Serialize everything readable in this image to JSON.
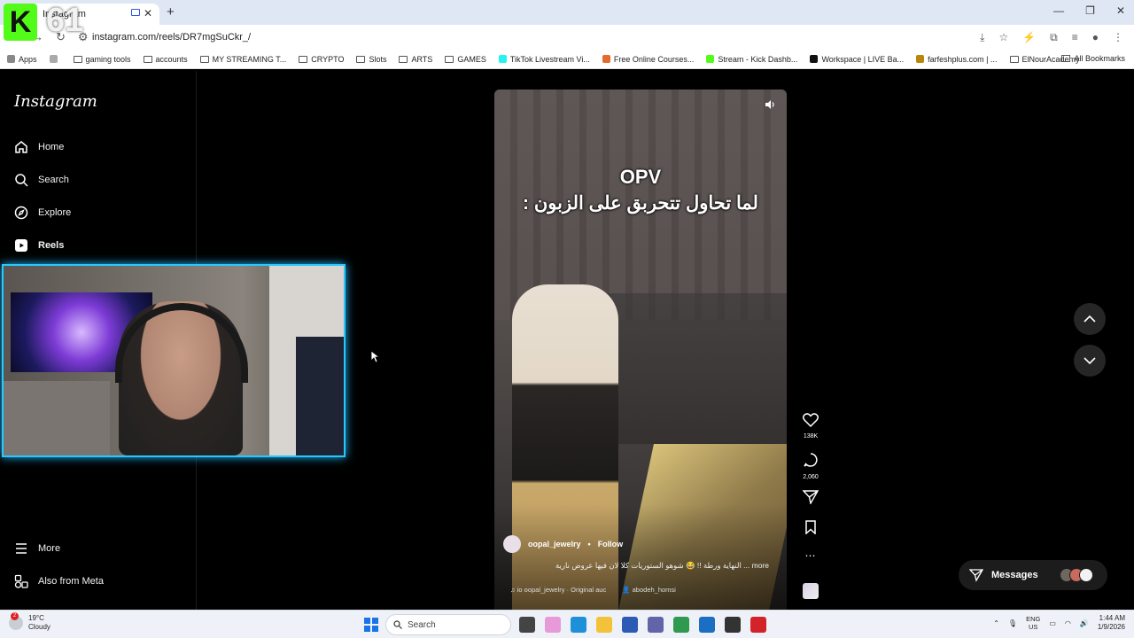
{
  "browser": {
    "tab_title": "Instagram",
    "url": "instagram.com/reels/DR7mgSuCkr_/",
    "bookmarks": [
      "gaming tools",
      "accounts",
      "MY STREAMING T...",
      "CRYPTO",
      "Slots",
      "ARTS",
      "GAMES",
      "TikTok Livestream Vi...",
      "Free Online Courses...",
      "Stream - Kick Dashb...",
      "Workspace | LIVE Ba...",
      "farfeshplus.com | ...",
      "ElNourAcademy"
    ],
    "apps_label": "Apps",
    "all_bookmarks_label": "All Bookmarks"
  },
  "overlay_badge": {
    "letter": "K",
    "number": "61"
  },
  "sidebar": {
    "logo": "Instagram",
    "items": [
      {
        "label": "Home",
        "icon": "home-icon"
      },
      {
        "label": "Search",
        "icon": "search-icon"
      },
      {
        "label": "Explore",
        "icon": "compass-icon"
      },
      {
        "label": "Reels",
        "icon": "reels-icon"
      }
    ],
    "bottom_items": [
      {
        "label": "More",
        "icon": "menu-icon"
      },
      {
        "label": "Also from Meta",
        "icon": "meta-icon"
      }
    ]
  },
  "reel": {
    "overlay_line1": "OPV",
    "overlay_line2": "لما تحاول تتحربق على الزبون :",
    "author": "oopal_jewelry",
    "separator": "•",
    "follow_label": "Follow",
    "caption": "more ... النهاية ورطة !! 😂 شوهو الستوريات كلا لان فيها عروض نارية",
    "audio": "oopal_jewelry · Original auc",
    "audio_prefix": "io",
    "tagged_user": "abodeh_homsi"
  },
  "actions": {
    "likes": "138K",
    "comments": "2,060"
  },
  "messages": {
    "label": "Messages"
  },
  "taskbar": {
    "temperature": "19°C",
    "condition": "Cloudy",
    "weather_badge": "2",
    "search_label": "Search",
    "lang_line1": "ENG",
    "lang_line2": "US",
    "time": "1:44 AM",
    "date": "1/9/2026"
  },
  "colors": {
    "kick_green": "#53fc18",
    "webcam_border": "#29c8ff",
    "taskbar_bg": "#eef2f8"
  }
}
